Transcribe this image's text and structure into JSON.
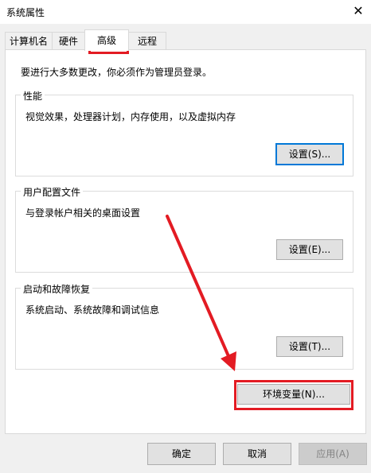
{
  "window": {
    "title": "系统属性",
    "close_glyph": "✕"
  },
  "tabs": [
    {
      "label": "计算机名"
    },
    {
      "label": "硬件"
    },
    {
      "label": "高级"
    },
    {
      "label": "远程"
    }
  ],
  "admin_note": "要进行大多数更改，你必须作为管理员登录。",
  "performance": {
    "title": "性能",
    "description": "视觉效果，处理器计划，内存使用，以及虚拟内存",
    "button": "设置(S)..."
  },
  "user_profiles": {
    "title": "用户配置文件",
    "description": "与登录帐户相关的桌面设置",
    "button": "设置(E)..."
  },
  "startup_recovery": {
    "title": "启动和故障恢复",
    "description": "系统启动、系统故障和调试信息",
    "button": "设置(T)..."
  },
  "env_button": "环境变量(N)...",
  "footer": {
    "ok": "确定",
    "cancel": "取消",
    "apply": "应用(A)"
  },
  "colors": {
    "highlight": "#e31b23",
    "focus_border": "#0078d7"
  }
}
